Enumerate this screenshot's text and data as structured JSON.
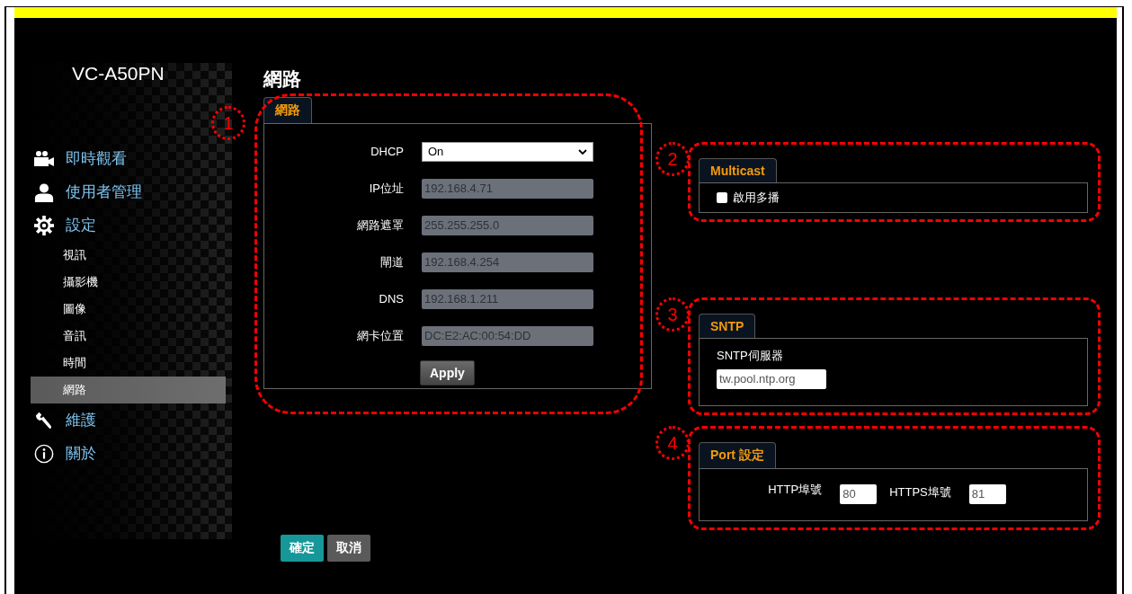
{
  "logo": "VC-A50PN",
  "sidebar": {
    "items": [
      {
        "label": "即時觀看",
        "kind": "camera",
        "selected": false
      },
      {
        "label": "使用者管理",
        "kind": "user",
        "selected": false
      },
      {
        "label": "設定",
        "kind": "gear",
        "selected": false,
        "children": [
          {
            "label": "視訊",
            "selected": false
          },
          {
            "label": "攝影機",
            "selected": false
          },
          {
            "label": "圖像",
            "selected": false
          },
          {
            "label": "音訊",
            "selected": false
          },
          {
            "label": "時間",
            "selected": false
          },
          {
            "label": "網路",
            "selected": true
          }
        ]
      },
      {
        "label": "維護",
        "kind": "wrench",
        "selected": false
      },
      {
        "label": "關於",
        "kind": "info",
        "selected": false
      }
    ]
  },
  "page_title": "網路",
  "network": {
    "callout": "1",
    "tab": "網路",
    "fields": [
      {
        "label": "DHCP",
        "kind": "select",
        "value": "On"
      },
      {
        "label": "IP位址",
        "kind": "text",
        "value": "192.168.4.71",
        "disabled": true
      },
      {
        "label": "網路遮罩",
        "kind": "text",
        "value": "255.255.255.0",
        "disabled": true
      },
      {
        "label": "閘道",
        "kind": "text",
        "value": "192.168.4.254",
        "disabled": true
      },
      {
        "label": "DNS",
        "kind": "text",
        "value": "192.168.1.211",
        "disabled": true
      },
      {
        "label": "網卡位置",
        "kind": "text",
        "value": "DC:E2:AC:00:54:DD",
        "disabled": true
      }
    ],
    "apply_button": "Apply"
  },
  "multicast": {
    "callout": "2",
    "tab": "Multicast",
    "checkbox": {
      "label": "啟用多播",
      "checked": false
    }
  },
  "sntp": {
    "callout": "3",
    "tab": "SNTP",
    "label": "SNTP伺服器",
    "value": "tw.pool.ntp.org"
  },
  "port": {
    "callout": "4",
    "tab": "Port 設定",
    "fields": [
      {
        "label": "HTTP埠號",
        "value": "80"
      },
      {
        "label": "HTTPS埠號",
        "value": "81"
      }
    ]
  },
  "buttons": [
    {
      "label": "確定",
      "kind": "primary"
    },
    {
      "label": "取消",
      "kind": "secondary"
    }
  ]
}
